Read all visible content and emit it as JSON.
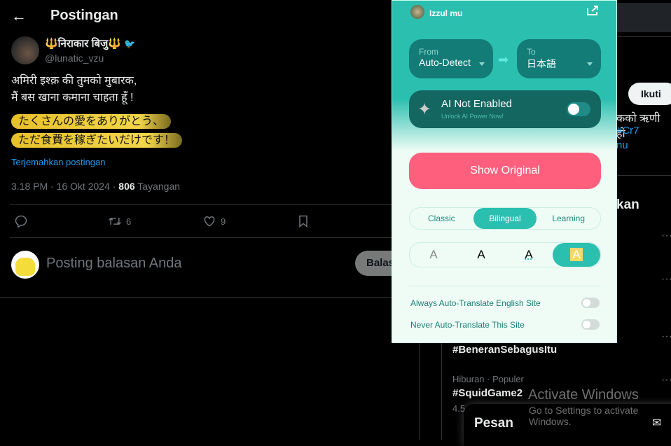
{
  "header": {
    "back_icon": "arrow-left-icon",
    "title": "Postingan"
  },
  "post": {
    "author_name": "🔱निराकार बिजु🔱",
    "handle": "@lunatic_vzu",
    "text_lines": [
      "अमिरी इश्क़ की तुमको मुबारक,",
      "मैं बस खाना कमाना चाहता हूँ !"
    ],
    "translation_lines": [
      "たくさんの愛をありがとう、",
      "ただ食費を稼ぎたいだけです！"
    ],
    "translate_link": "Terjemahkan postingan",
    "time": "3.18 PM · 16 Okt 2024 · ",
    "views": "806",
    "views_label": " Tayangan",
    "actions": {
      "reply": "",
      "retweet": "6",
      "like": "9"
    }
  },
  "reply": {
    "placeholder": "Posting balasan Anda",
    "button": "Balas"
  },
  "right": {
    "follow": "Ikuti",
    "snippet": [
      "कको ऋणी हो",
      "#Cr7",
      "nu"
    ],
    "section_heading": "kan",
    "trends": [
      {
        "name": "#BeneranSebagusItu"
      },
      {
        "category": "Hiburan · Populer",
        "name": "#SquidGame2",
        "count": "4.5"
      }
    ],
    "messages": "Pesan"
  },
  "popup": {
    "user": "Izzul mu",
    "from_label": "From",
    "from_value": "Auto-Detect",
    "to_label": "To",
    "to_value": "日本語",
    "ai_title": "AI Not Enabled",
    "ai_sub": "Unlock AI Power Now!",
    "show_original": "Show Original",
    "modes": [
      "Classic",
      "Bilingual",
      "Learning"
    ],
    "active_mode": "Bilingual",
    "styles": [
      "A",
      "A",
      "A",
      "A"
    ],
    "opt1": "Always Auto-Translate English Site",
    "opt2": "Never Auto-Translate This Site",
    "colors": {
      "teal": "#2bbfb0",
      "pink": "#fd5f7d",
      "dark_teal": "#146660"
    }
  },
  "watermark": {
    "line1": "Activate Windows",
    "line2": "Go to Settings to activate Windows."
  }
}
